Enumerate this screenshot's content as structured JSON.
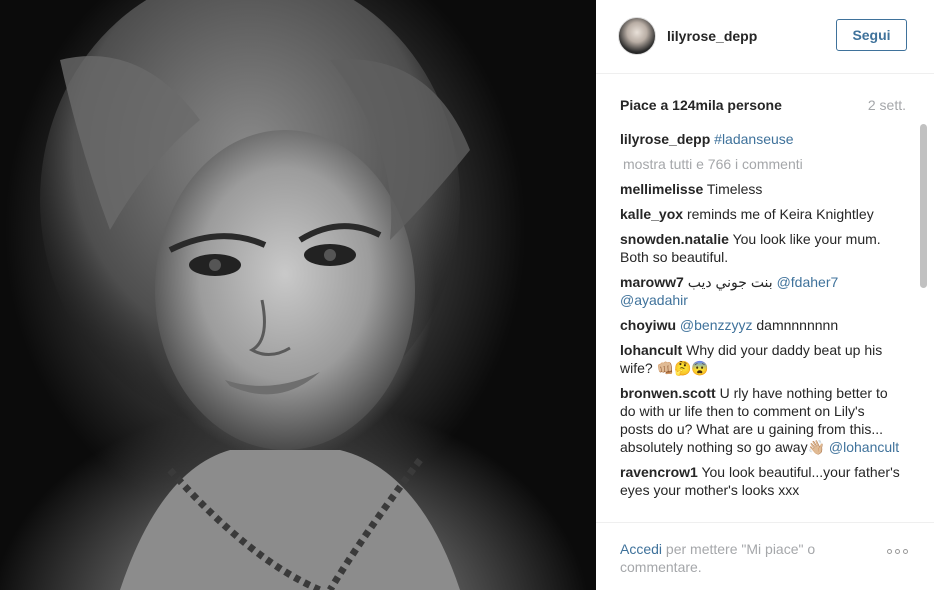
{
  "post": {
    "username": "lilyrose_depp",
    "follow_label": "Segui",
    "likes_text": "Piace a 124mila persone",
    "time": "2 sett.",
    "caption_user": "lilyrose_depp",
    "caption_tag": "#ladanseuse",
    "view_all": "mostra tutti e 766 i commenti"
  },
  "comments": [
    {
      "user": "mellimelisse",
      "parts": [
        {
          "t": "Timeless"
        }
      ]
    },
    {
      "user": "kalle_yox",
      "parts": [
        {
          "t": "reminds me of Keira Knightley"
        }
      ]
    },
    {
      "user": "snowden.natalie",
      "parts": [
        {
          "t": "You look like your mum. Both so beautiful."
        }
      ]
    },
    {
      "user": "maroww7",
      "parts": [
        {
          "t": "بنت جوني ديب "
        },
        {
          "m": "@fdaher7"
        },
        {
          "t": " "
        },
        {
          "m": "@ayadahir"
        }
      ]
    },
    {
      "user": "choyiwu",
      "parts": [
        {
          "m": "@benzzyyz"
        },
        {
          "t": " damnnnnnnn"
        }
      ]
    },
    {
      "user": "lohancult",
      "parts": [
        {
          "t": "Why did your daddy beat up his wife? 👊🏼🤔😨"
        }
      ]
    },
    {
      "user": "bronwen.scott",
      "parts": [
        {
          "t": "U rly have nothing better to do with ur life then to comment on Lily's posts do u? What are u gaining from this... absolutely nothing so go away👋🏼 "
        },
        {
          "m": "@lohancult"
        }
      ]
    },
    {
      "user": "ravencrow1",
      "parts": [
        {
          "t": "You look beautiful...your father's eyes your mother's looks xxx"
        }
      ]
    }
  ],
  "footer": {
    "login_link": "Accedi",
    "login_rest": " per mettere \"Mi piace\" o commentare."
  },
  "icons": {
    "more": "more-options-icon"
  },
  "colors": {
    "link": "#3f729b",
    "muted": "#a5a7aa",
    "text": "#262626"
  }
}
